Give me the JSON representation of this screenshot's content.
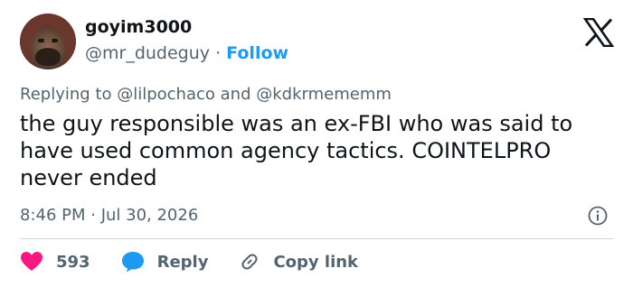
{
  "author": {
    "display_name": "goyim3000",
    "handle": "@mr_dudeguy",
    "separator": "·",
    "follow_label": "Follow"
  },
  "platform_icon": "x-logo-icon",
  "reply_context": {
    "prefix": "Replying to",
    "mention_1": "@lilpochaco",
    "joiner": "and",
    "mention_2": "@kdkrmememm"
  },
  "tweet": {
    "text": "the guy responsible was an ex-FBI who was said to have used common agency tactics. COINTELPRO never ended",
    "timestamp": "8:46 PM · Jul 30, 2026"
  },
  "actions": {
    "likes_count": "593",
    "reply_label": "Reply",
    "copy_link_label": "Copy link"
  },
  "colors": {
    "like": "#f91880",
    "reply": "#1d9bf0",
    "follow": "#1d9bf0",
    "muted": "#536471"
  }
}
